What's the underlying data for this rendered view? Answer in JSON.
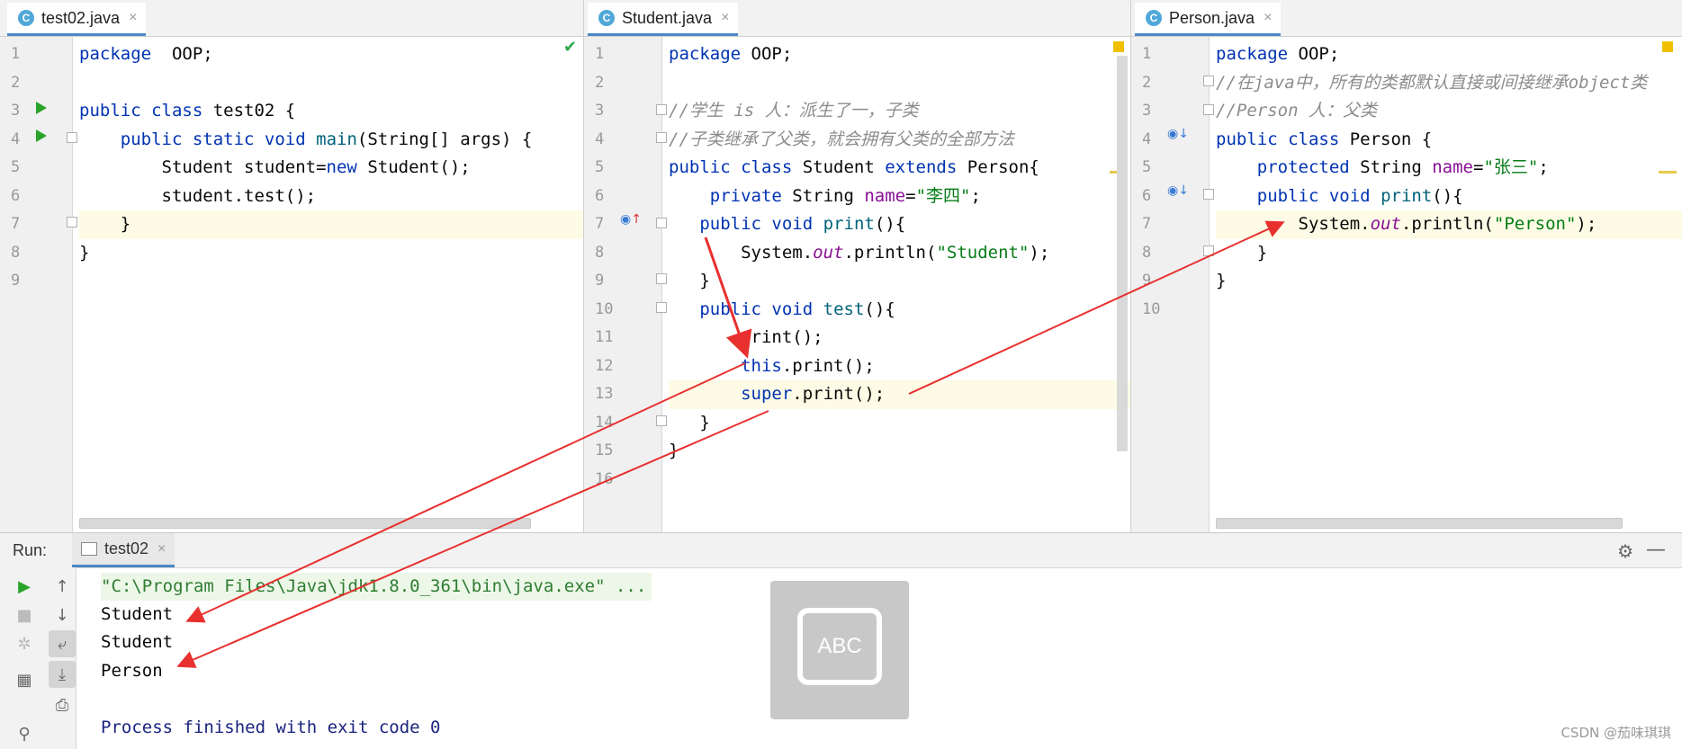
{
  "panes": [
    {
      "tab": "test02.java",
      "lines": [
        {
          "n": "1",
          "tokens": [
            [
              "kw",
              "package"
            ],
            [
              "",
              "  OOP;"
            ]
          ]
        },
        {
          "n": "2",
          "tokens": []
        },
        {
          "n": "3",
          "tokens": [
            [
              "kw",
              "public class"
            ],
            [
              "",
              " test02 {"
            ]
          ]
        },
        {
          "n": "4",
          "tokens": [
            [
              "",
              "    "
            ],
            [
              "kw",
              "public static void"
            ],
            [
              "",
              " "
            ],
            [
              "fn",
              "main"
            ],
            [
              "",
              "(String[] args) {"
            ]
          ]
        },
        {
          "n": "5",
          "tokens": [
            [
              "",
              "        Student student="
            ],
            [
              "kw",
              "new"
            ],
            [
              "",
              " Student();"
            ]
          ]
        },
        {
          "n": "6",
          "tokens": [
            [
              "",
              "        student.test();"
            ]
          ]
        },
        {
          "n": "7",
          "tokens": [
            [
              "",
              "    }"
            ]
          ]
        },
        {
          "n": "8",
          "tokens": [
            [
              "",
              "}"
            ]
          ]
        },
        {
          "n": "9",
          "tokens": []
        }
      ]
    },
    {
      "tab": "Student.java",
      "lines": [
        {
          "n": "1",
          "tokens": [
            [
              "kw",
              "package"
            ],
            [
              "",
              " OOP;"
            ]
          ]
        },
        {
          "n": "2",
          "tokens": []
        },
        {
          "n": "3",
          "tokens": [
            [
              "cm",
              "//学生 is 人：派生了一，子类"
            ]
          ]
        },
        {
          "n": "4",
          "tokens": [
            [
              "cm",
              "//子类继承了父类，就会拥有父类的全部方法"
            ]
          ]
        },
        {
          "n": "5",
          "tokens": [
            [
              "kw",
              "public class"
            ],
            [
              "",
              " Student "
            ],
            [
              "kw",
              "extends"
            ],
            [
              "",
              " Person{"
            ]
          ]
        },
        {
          "n": "6",
          "tokens": [
            [
              "",
              "    "
            ],
            [
              "kw",
              "private"
            ],
            [
              "",
              " String "
            ],
            [
              "fld",
              "name"
            ],
            [
              "",
              "="
            ],
            [
              "str",
              "\"李四\""
            ],
            [
              "",
              ";"
            ]
          ]
        },
        {
          "n": "7",
          "tokens": [
            [
              "",
              "   "
            ],
            [
              "kw",
              "public void"
            ],
            [
              "",
              " "
            ],
            [
              "fn",
              "print"
            ],
            [
              "",
              "(){"
            ]
          ]
        },
        {
          "n": "8",
          "tokens": [
            [
              "",
              "       System."
            ],
            [
              "st",
              "out"
            ],
            [
              "",
              ".println("
            ],
            [
              "str",
              "\"Student\""
            ],
            [
              "",
              ");"
            ]
          ]
        },
        {
          "n": "9",
          "tokens": [
            [
              "",
              "   }"
            ]
          ]
        },
        {
          "n": "10",
          "tokens": [
            [
              "",
              "   "
            ],
            [
              "kw",
              "public void"
            ],
            [
              "",
              " "
            ],
            [
              "fn",
              "test"
            ],
            [
              "",
              "(){"
            ]
          ]
        },
        {
          "n": "11",
          "tokens": [
            [
              "",
              "       print();"
            ]
          ]
        },
        {
          "n": "12",
          "tokens": [
            [
              "",
              "       "
            ],
            [
              "kw",
              "this"
            ],
            [
              "",
              ".print();"
            ]
          ]
        },
        {
          "n": "13",
          "tokens": [
            [
              "",
              "       "
            ],
            [
              "kw",
              "super"
            ],
            [
              "",
              ".print();"
            ]
          ]
        },
        {
          "n": "14",
          "tokens": [
            [
              "",
              "   }"
            ]
          ]
        },
        {
          "n": "15",
          "tokens": [
            [
              "",
              "}"
            ]
          ]
        },
        {
          "n": "16",
          "tokens": []
        }
      ]
    },
    {
      "tab": "Person.java",
      "lines": [
        {
          "n": "1",
          "tokens": [
            [
              "kw",
              "package"
            ],
            [
              "",
              " OOP;"
            ]
          ]
        },
        {
          "n": "2",
          "tokens": [
            [
              "cm",
              "//在java中，所有的类都默认直接或间接继承object类"
            ]
          ]
        },
        {
          "n": "3",
          "tokens": [
            [
              "cm",
              "//Person 人：父类"
            ]
          ]
        },
        {
          "n": "4",
          "tokens": [
            [
              "kw",
              "public class"
            ],
            [
              "",
              " Person {"
            ]
          ]
        },
        {
          "n": "5",
          "tokens": [
            [
              "",
              "    "
            ],
            [
              "kw",
              "protected"
            ],
            [
              "",
              " String "
            ],
            [
              "fld",
              "name"
            ],
            [
              "",
              "="
            ],
            [
              "str",
              "\"张三\""
            ],
            [
              "",
              ";"
            ]
          ]
        },
        {
          "n": "6",
          "tokens": [
            [
              "",
              "    "
            ],
            [
              "kw",
              "public void"
            ],
            [
              "",
              " "
            ],
            [
              "fn",
              "print"
            ],
            [
              "",
              "(){"
            ]
          ]
        },
        {
          "n": "7",
          "tokens": [
            [
              "",
              "        System."
            ],
            [
              "st",
              "out"
            ],
            [
              "",
              ".println("
            ],
            [
              "str",
              "\"Person\""
            ],
            [
              "",
              ");"
            ]
          ]
        },
        {
          "n": "8",
          "tokens": [
            [
              "",
              "    }"
            ]
          ]
        },
        {
          "n": "9",
          "tokens": [
            [
              "",
              "}"
            ]
          ]
        },
        {
          "n": "10",
          "tokens": []
        }
      ]
    }
  ],
  "run": {
    "label": "Run:",
    "tab": "test02",
    "output": [
      "\"C:\\Program Files\\Java\\jdk1.8.0_361\\bin\\java.exe\" ...",
      "Student",
      "Student",
      "Person",
      "",
      "Process finished with exit code 0"
    ],
    "input_badge": "ABC",
    "watermark": "CSDN @茄味琪琪"
  },
  "colors": {
    "accent": "#4a88c7",
    "keyword": "#0033b3",
    "string": "#067d17",
    "arrow": "#e8302f"
  }
}
